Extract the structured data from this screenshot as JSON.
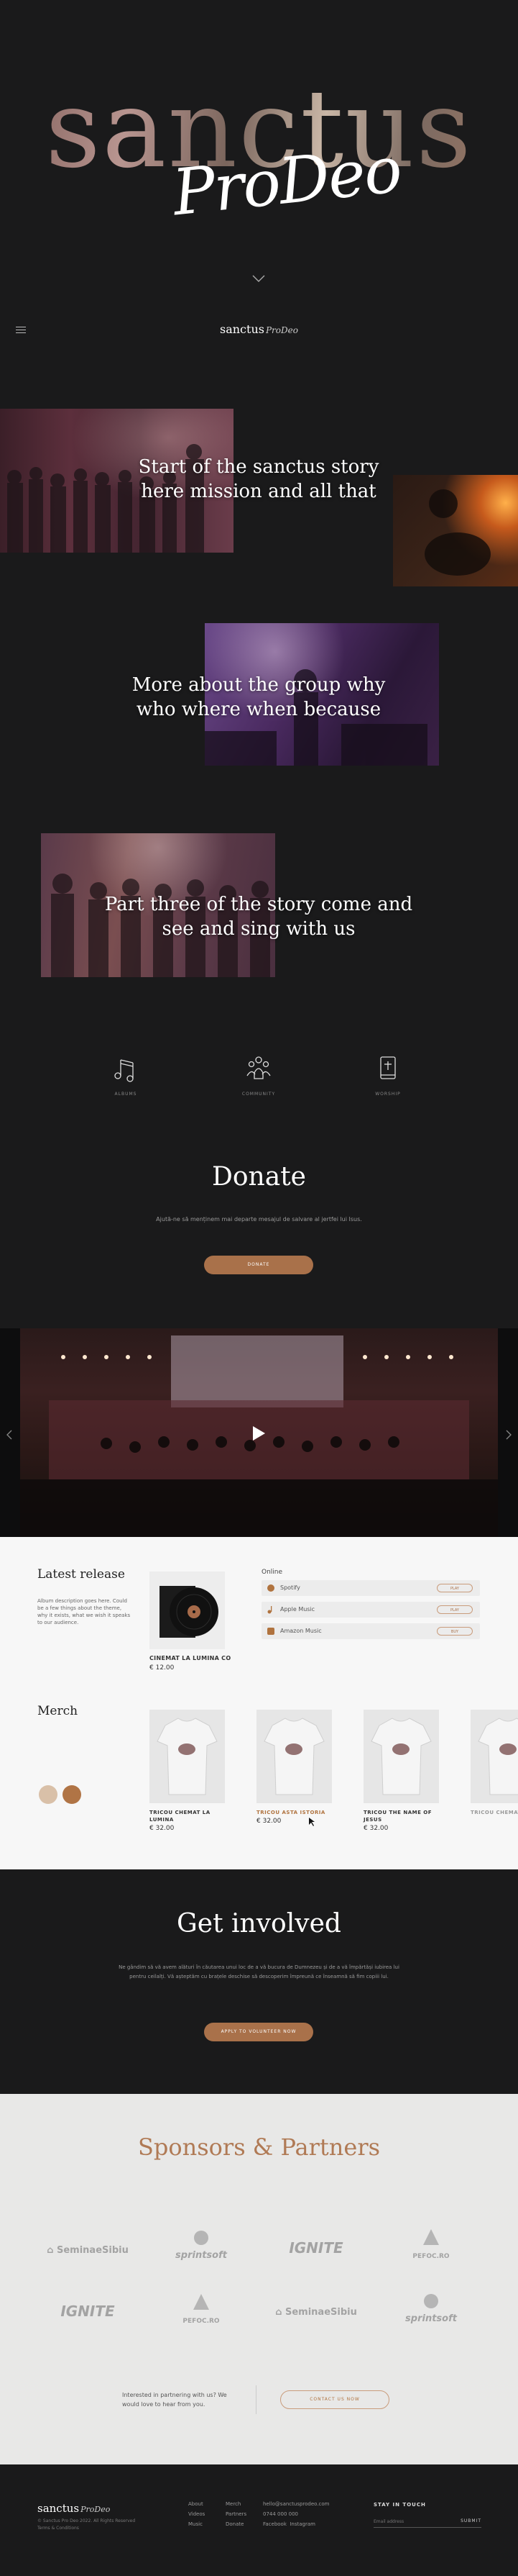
{
  "hero": {
    "title": "sanctus",
    "script": "ProDeo"
  },
  "nav": {
    "logo": "sanctus",
    "logo_script": "ProDeo"
  },
  "story": {
    "part1": "Start of the sanctus story here mission and all that",
    "part2": "More about the group why who where when because",
    "part3": "Part three of the story come and see and sing with us"
  },
  "features": [
    {
      "label": "ALBUMS",
      "icon": "music-notes-icon"
    },
    {
      "label": "COMMUNITY",
      "icon": "community-icon"
    },
    {
      "label": "WORSHIP",
      "icon": "bible-icon"
    }
  ],
  "donate": {
    "title": "Donate",
    "description": "Ajută-ne să menținem mai departe mesajul de salvare al jertfei lui Isus.",
    "button": "DONATE"
  },
  "release": {
    "heading": "Latest release",
    "description": "Album description goes here. Could be a few things about the theme, why it exists, what we wish it speaks to our audience.",
    "album_name": "CINEMAT LA LUMINA CO",
    "album_price": "€ 12.00",
    "online_label": "Online",
    "platforms": [
      {
        "name": "Spotify",
        "icon": "spotify-icon",
        "action": "PLAY"
      },
      {
        "name": "Apple Music",
        "icon": "apple-music-icon",
        "action": "PLAY"
      },
      {
        "name": "Amazon Music",
        "icon": "amazon-music-icon",
        "action": "BUY"
      }
    ]
  },
  "merch": {
    "heading": "Merch",
    "swatch_colors": [
      "#d9c0a8",
      "#b07445"
    ],
    "products": [
      {
        "name": "TRICOU CHEMAT LA LUMINA",
        "price": "€ 32.00",
        "highlight": false
      },
      {
        "name": "TRICOU ASTA ISTORIA",
        "price": "€ 32.00",
        "highlight": true
      },
      {
        "name": "TRICOU THE NAME OF JESUS",
        "price": "€ 32.00",
        "highlight": false
      },
      {
        "name": "TRICOU CHEMAT LA LUMINA",
        "price": "",
        "highlight": false
      }
    ]
  },
  "involved": {
    "title": "Get involved",
    "description": "Ne gândim să vă avem alături în căutarea unui loc de a vă bucura de Dumnezeu și de a vă împărtăși iubirea lui pentru ceilalți. Vă așteptăm cu brațele deschise să descoperim împreună ce înseamnă să fim copiii lui.",
    "button": "APPLY TO VOLUNTEER NOW"
  },
  "sponsors": {
    "title": "Sponsors & Partners",
    "logos": [
      "SeminaeSibiu",
      "sprintsoft",
      "IGNITE",
      "PEFOC.RO",
      "IGNITE",
      "PEFOC.RO",
      "SeminaeSibiu",
      "sprintsoft"
    ],
    "cta_text": "Interested in partnering with us? We would love to hear from you.",
    "cta_button": "CONTACT US NOW"
  },
  "footer": {
    "logo": "sanctus",
    "logo_script": "ProDeo",
    "copyright": "© Sanctus Pro Deo 2022. All Rights Reserved",
    "terms": "Terms & Conditions",
    "col1": [
      "About",
      "Videos",
      "Music"
    ],
    "col2": [
      "Merch",
      "Partners",
      "Donate"
    ],
    "col3": [
      "hello@sanctusprodeo.com",
      "0744 000 000",
      "Facebook",
      "Instagram"
    ],
    "newsletter_title": "STAY IN TOUCH",
    "newsletter_placeholder": "Email address",
    "newsletter_button": "SUBMIT"
  },
  "colors": {
    "accent": "#a9714a",
    "dark_bg": "#1a1a1b",
    "light_bg": "#f7f7f7",
    "sponsor_bg": "#e8e8e7"
  }
}
